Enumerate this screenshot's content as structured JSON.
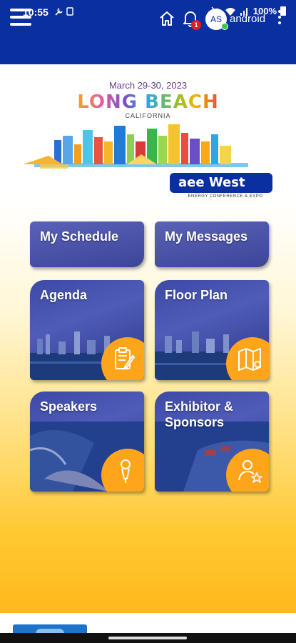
{
  "status_bar": {
    "time": "10:55",
    "battery": "100%",
    "icons": [
      "wrench-icon",
      "card-icon",
      "mute-icon",
      "wifi-icon",
      "signal-icon",
      "battery-icon"
    ]
  },
  "app_bar": {
    "background": "#0a2fa0",
    "avatar_initials": "AS",
    "username": "android",
    "notification_count": "1"
  },
  "event": {
    "date": "March 29-30, 2023",
    "city": "LONG BEACH",
    "state": "CALIFORNIA",
    "brand": "aee West",
    "tagline": "ENERGY CONFERENCE & EXPO"
  },
  "tiles": [
    {
      "label": "My Schedule"
    },
    {
      "label": "My Messages"
    },
    {
      "label": "Agenda",
      "icon": "clipboard-edit-icon"
    },
    {
      "label": "Floor Plan",
      "icon": "map-pin-icon"
    },
    {
      "label": "Speakers",
      "icon": "microphone-icon"
    },
    {
      "label": "Exhibitor & Sponsors",
      "icon": "person-star-icon"
    }
  ],
  "colors": {
    "accent_orange": "#ffa51c",
    "tile_blue": "#3d49a6",
    "badge_red": "#e31b23"
  }
}
